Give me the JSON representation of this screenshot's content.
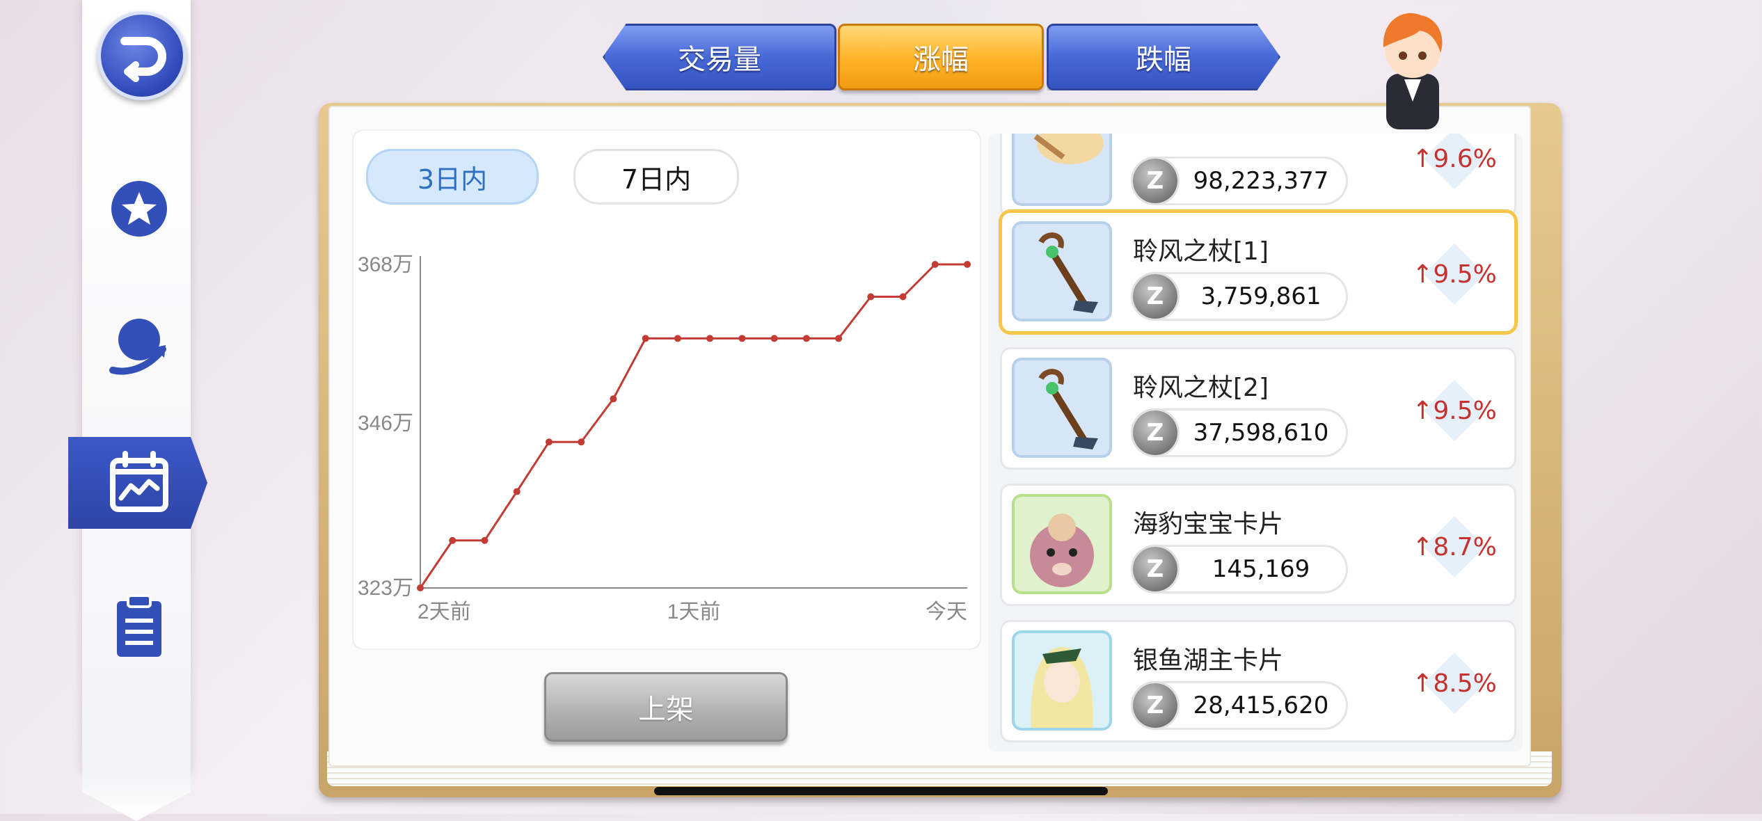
{
  "tabs": [
    {
      "label": "交易量",
      "active": false
    },
    {
      "label": "涨幅",
      "active": true
    },
    {
      "label": "跌幅",
      "active": false
    }
  ],
  "nav": [
    {
      "icon": "back-icon"
    },
    {
      "icon": "star-icon"
    },
    {
      "icon": "globe-arrow-icon"
    },
    {
      "icon": "calendar-chart-icon",
      "active": true
    },
    {
      "icon": "clipboard-icon"
    }
  ],
  "range": {
    "option1": "3日内",
    "option2": "7日内",
    "active": "3日内"
  },
  "chart_data": {
    "type": "line",
    "title": "",
    "xlabel": "",
    "ylabel": "",
    "y_ticks": [
      "323万",
      "346万",
      "368万"
    ],
    "x_ticks": [
      "2天前",
      "1天前",
      "今天"
    ],
    "ylim": [
      3230000,
      3680000
    ],
    "color": "#c23b34",
    "x": [
      0,
      1,
      2,
      3,
      4,
      5,
      6,
      7,
      8,
      9,
      10,
      11,
      12,
      13,
      14,
      15,
      16,
      17
    ],
    "values": [
      3230000,
      3296000,
      3296000,
      3364000,
      3433000,
      3433000,
      3493000,
      3577000,
      3577000,
      3577000,
      3577000,
      3577000,
      3577000,
      3577000,
      3635000,
      3635000,
      3680000,
      3680000
    ]
  },
  "list_button": "上架",
  "items": [
    {
      "name": "",
      "price": "98,223,377",
      "change": "↑9.6%",
      "thumb": "item"
    },
    {
      "name": "聆风之杖[1]",
      "price": "3,759,861",
      "change": "↑9.5%",
      "thumb": "staff",
      "selected": true
    },
    {
      "name": "聆风之杖[2]",
      "price": "37,598,610",
      "change": "↑9.5%",
      "thumb": "staff"
    },
    {
      "name": "海豹宝宝卡片",
      "price": "145,169",
      "change": "↑8.7%",
      "thumb": "card"
    },
    {
      "name": "银鱼湖主卡片",
      "price": "28,415,620",
      "change": "↑8.5%",
      "thumb": "card2"
    }
  ],
  "zeny_symbol": "Z"
}
